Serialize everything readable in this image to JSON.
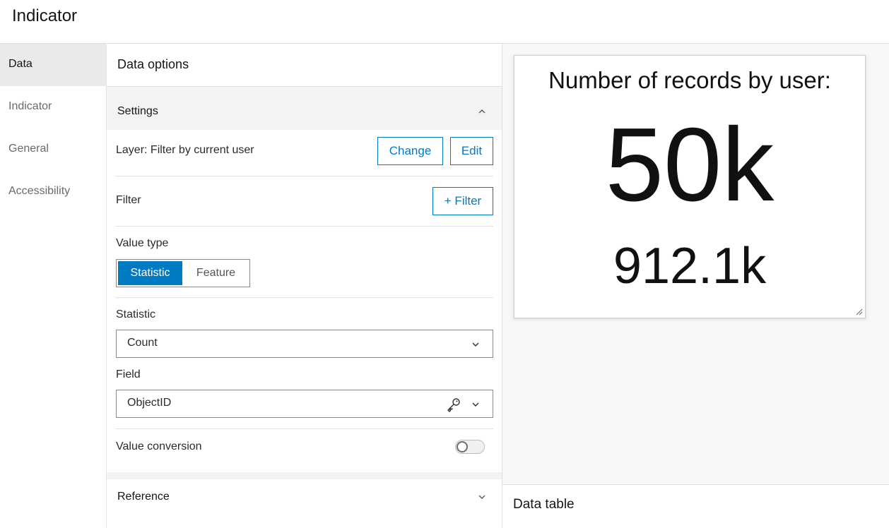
{
  "app": {
    "title": "Indicator"
  },
  "nav": {
    "items": [
      {
        "label": "Data",
        "active": true
      },
      {
        "label": "Indicator",
        "active": false
      },
      {
        "label": "General",
        "active": false
      },
      {
        "label": "Accessibility",
        "active": false
      }
    ]
  },
  "panel": {
    "header": "Data options",
    "settings": {
      "title": "Settings",
      "layer_label": "Layer: Filter by current user",
      "change_label": "Change",
      "edit_label": "Edit",
      "filter_label": "Filter",
      "add_filter_label": "+ Filter",
      "value_type_label": "Value type",
      "value_type_options": [
        "Statistic",
        "Feature"
      ],
      "value_type_selected": "Statistic",
      "statistic_label": "Statistic",
      "statistic_value": "Count",
      "field_label": "Field",
      "field_value": "ObjectID",
      "value_conversion_label": "Value conversion",
      "value_conversion_on": false
    },
    "reference": {
      "title": "Reference"
    }
  },
  "preview": {
    "card_title": "Number of records by user:",
    "top_value": "50k",
    "bottom_value": "912.1k"
  },
  "data_table": {
    "label": "Data table"
  },
  "colors": {
    "accent": "#007ac2",
    "nav_active_bg": "#eaeaea",
    "section_bg": "#f3f3f3"
  }
}
